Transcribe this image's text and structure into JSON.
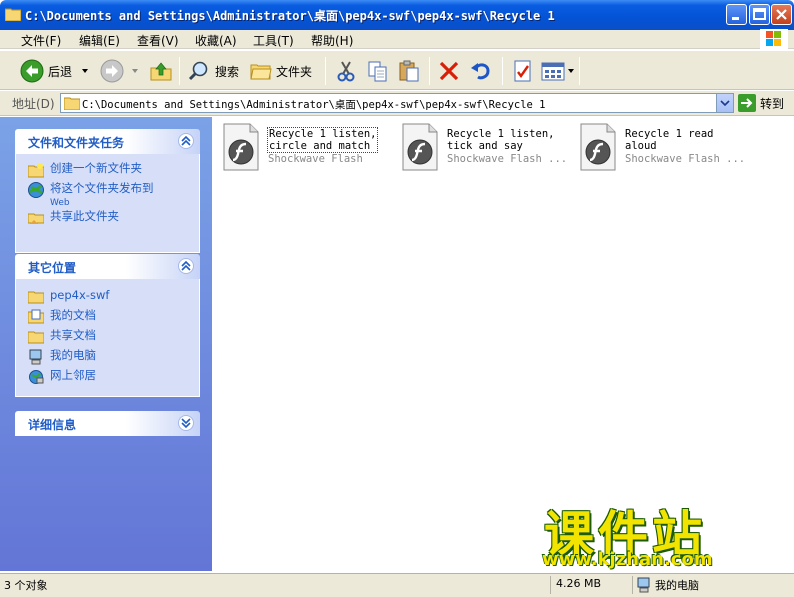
{
  "window": {
    "title": "C:\\Documents and Settings\\Administrator\\桌面\\pep4x-swf\\pep4x-swf\\Recycle 1"
  },
  "menu": [
    "文件(F)",
    "编辑(E)",
    "查看(V)",
    "收藏(A)",
    "工具(T)",
    "帮助(H)"
  ],
  "toolbar": {
    "back_label": "后退",
    "search_label": "搜索",
    "folders_label": "文件夹"
  },
  "address": {
    "label": "地址(D)",
    "value": "C:\\Documents and Settings\\Administrator\\桌面\\pep4x-swf\\pep4x-swf\\Recycle 1",
    "go_label": "转到"
  },
  "tasks_panel": {
    "title": "文件和文件夹任务",
    "items": [
      {
        "label": "创建一个新文件夹",
        "icon": "new-folder-icon"
      },
      {
        "label": "将这个文件夹发布到",
        "sub": "Web",
        "icon": "publish-web-icon"
      },
      {
        "label": "共享此文件夹",
        "icon": "share-folder-icon"
      }
    ]
  },
  "places_panel": {
    "title": "其它位置",
    "items": [
      {
        "label": "pep4x-swf",
        "icon": "folder-icon"
      },
      {
        "label": "我的文档",
        "icon": "my-documents-icon"
      },
      {
        "label": "共享文档",
        "icon": "shared-documents-icon"
      },
      {
        "label": "我的电脑",
        "icon": "my-computer-icon"
      },
      {
        "label": "网上邻居",
        "icon": "network-icon"
      }
    ]
  },
  "details_panel": {
    "title": "详细信息"
  },
  "files": [
    {
      "line1": "Recycle 1 listen,",
      "line2": "circle and match",
      "type": "Shockwave Flash",
      "selected": true
    },
    {
      "line1": "Recycle 1 listen,",
      "line2": "tick and say",
      "type": "Shockwave Flash ...",
      "selected": false
    },
    {
      "line1": "Recycle 1 read",
      "line2": "aloud",
      "type": "Shockwave Flash ...",
      "selected": false
    }
  ],
  "watermark": {
    "text": "课件站",
    "url": "www.kjzhan.com"
  },
  "status": {
    "count": "3 个对象",
    "size": "4.26 MB",
    "location": "我的电脑"
  }
}
